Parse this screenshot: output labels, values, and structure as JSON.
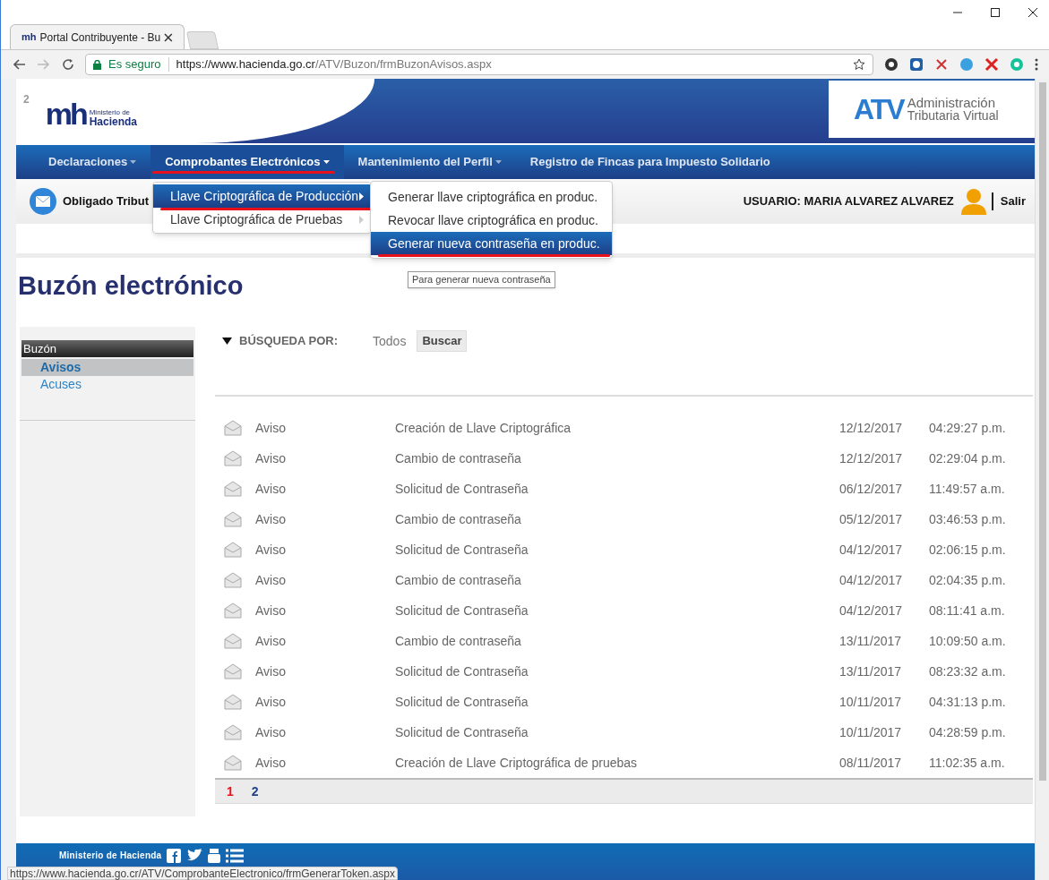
{
  "browser": {
    "tab_icon": "mh",
    "tab_title": "Portal Contribuyente - Bu",
    "secure_label": "Es seguro",
    "url_host": "https://www.hacienda.go.cr",
    "url_path": "/ATV/Buzon/frmBuzonAvisos.aspx"
  },
  "header": {
    "badge": "2",
    "logo_mark": "mh",
    "logo_line1": "Ministerio de",
    "logo_line2": "Hacienda",
    "atv_mark": "ATV",
    "atv_line1": "Administración",
    "atv_line2": "Tributaria Virtual"
  },
  "nav": [
    {
      "label": "Declaraciones",
      "has_caret": true,
      "selected": false
    },
    {
      "label": "Comprobantes Electrónicos",
      "has_caret": true,
      "selected": true
    },
    {
      "label": "Mantenimiento del Perfil",
      "has_caret": true,
      "selected": false
    },
    {
      "label": "Registro de Fincas para Impuesto Solidario",
      "has_caret": false,
      "selected": false
    }
  ],
  "user_bar": {
    "title": "Obligado Tribut",
    "user": "USUARIO: MARIA ALVAREZ ALVAREZ",
    "logout": "Salir"
  },
  "menu": [
    {
      "label": "Llave Criptográfica de Producción",
      "selected": true
    },
    {
      "label": "Llave Criptográfica de Pruebas",
      "selected": false
    }
  ],
  "submenu": [
    {
      "label": "Generar llave criptográfica en produc.",
      "selected": false
    },
    {
      "label": "Revocar llave criptográfica en produc.",
      "selected": false
    },
    {
      "label": "Generar nueva contraseña en produc.",
      "selected": true
    }
  ],
  "tooltip": "Para generar nueva contraseña",
  "page_title": "Buzón electrónico",
  "sidebar": {
    "heading": "Buzón",
    "items": [
      {
        "label": "Avisos",
        "selected": true
      },
      {
        "label": "Acuses",
        "selected": false
      }
    ]
  },
  "search": {
    "label": "BÚSQUEDA POR:",
    "value": "Todos",
    "button": "Buscar"
  },
  "rows": [
    {
      "type": "Aviso",
      "subject": "Creación de Llave Criptográfica",
      "date": "12/12/2017",
      "time": "04:29:27 p.m."
    },
    {
      "type": "Aviso",
      "subject": "Cambio de contraseña",
      "date": "12/12/2017",
      "time": "02:29:04 p.m."
    },
    {
      "type": "Aviso",
      "subject": "Solicitud de Contraseña",
      "date": "06/12/2017",
      "time": "11:49:57 a.m."
    },
    {
      "type": "Aviso",
      "subject": "Cambio de contraseña",
      "date": "05/12/2017",
      "time": "03:46:53 p.m."
    },
    {
      "type": "Aviso",
      "subject": "Solicitud de Contraseña",
      "date": "04/12/2017",
      "time": "02:06:15 p.m."
    },
    {
      "type": "Aviso",
      "subject": "Cambio de contraseña",
      "date": "04/12/2017",
      "time": "02:04:35 p.m."
    },
    {
      "type": "Aviso",
      "subject": "Solicitud de Contraseña",
      "date": "04/12/2017",
      "time": "08:11:41 a.m."
    },
    {
      "type": "Aviso",
      "subject": "Cambio de contraseña",
      "date": "13/11/2017",
      "time": "10:09:50 a.m."
    },
    {
      "type": "Aviso",
      "subject": "Solicitud de Contraseña",
      "date": "13/11/2017",
      "time": "08:23:32 a.m."
    },
    {
      "type": "Aviso",
      "subject": "Solicitud de Contraseña",
      "date": "10/11/2017",
      "time": "04:31:13 p.m."
    },
    {
      "type": "Aviso",
      "subject": "Solicitud de Contraseña",
      "date": "10/11/2017",
      "time": "04:28:59 p.m."
    },
    {
      "type": "Aviso",
      "subject": "Creación de Llave Criptográfica de pruebas",
      "date": "08/11/2017",
      "time": "11:02:35 a.m."
    }
  ],
  "pagination": [
    {
      "label": "1",
      "selected": true
    },
    {
      "label": "2",
      "selected": false
    }
  ],
  "footer": {
    "label": "Ministerio de Hacienda"
  },
  "status_url": "https://www.hacienda.go.cr/ATV/ComprobanteElectronico/frmGenerarToken.aspx"
}
